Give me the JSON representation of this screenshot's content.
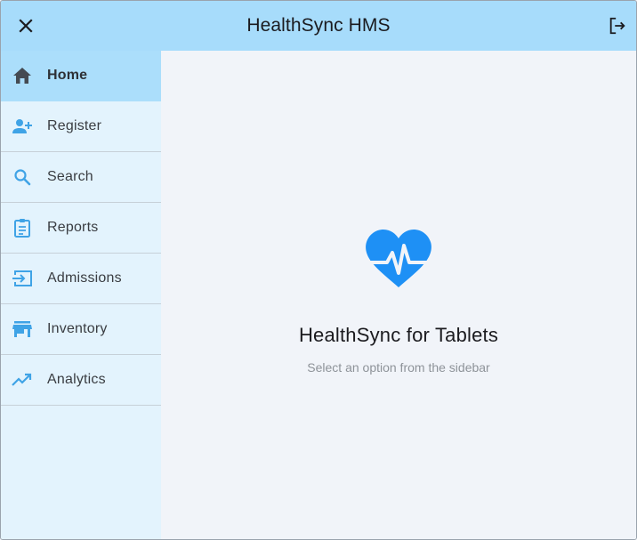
{
  "appbar": {
    "title": "HealthSync HMS",
    "close_icon": "close-icon",
    "logout_icon": "logout-icon",
    "background": "#a7dcfb"
  },
  "sidebar": {
    "items": [
      {
        "label": "Home",
        "icon": "home-icon",
        "active": true
      },
      {
        "label": "Register",
        "icon": "person-add-icon",
        "active": false
      },
      {
        "label": "Search",
        "icon": "search-icon",
        "active": false
      },
      {
        "label": "Reports",
        "icon": "clipboard-icon",
        "active": false
      },
      {
        "label": "Admissions",
        "icon": "login-arrow-icon",
        "active": false
      },
      {
        "label": "Inventory",
        "icon": "store-icon",
        "active": false
      },
      {
        "label": "Analytics",
        "icon": "trending-up-icon",
        "active": false
      }
    ],
    "background": "#e3f3fd",
    "active_background": "#abdefb",
    "icon_color": "#3fa3e6"
  },
  "main": {
    "hero_icon": "heartbeat-icon",
    "hero_icon_color": "#1e90f5",
    "title": "HealthSync for Tablets",
    "subtitle": "Select an option from the sidebar"
  }
}
